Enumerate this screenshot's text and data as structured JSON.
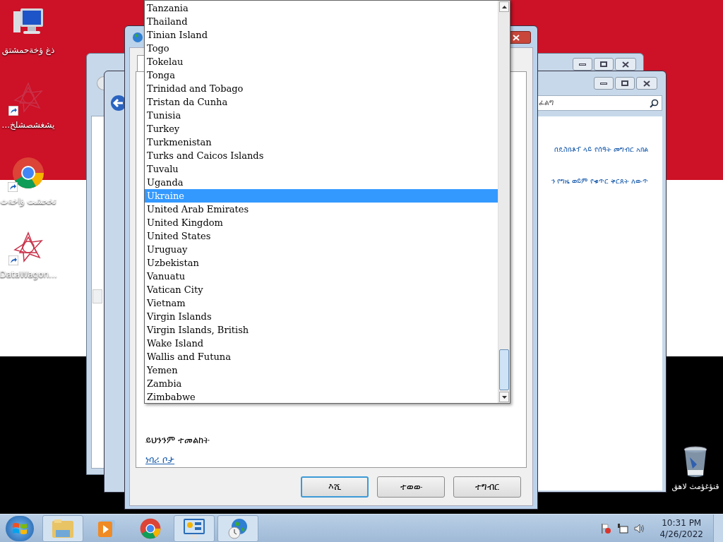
{
  "desktop_icons": [
    {
      "label": "ذغ ؤخةحمشتق",
      "kind": "computer",
      "shortcut": false
    },
    {
      "label": "...يشغشصشلخ",
      "kind": "star",
      "shortcut": true
    },
    {
      "label": "تخحشت ؤاخةث",
      "kind": "chrome",
      "shortcut": true
    },
    {
      "label": "DataWagon...",
      "kind": "star",
      "shortcut": true
    }
  ],
  "recycle_bin": {
    "label": "قنؤغؤمث لاهق"
  },
  "explorer_window": {
    "search_placeholder": "ፈልግ",
    "links": [
      "በዴስክቶፕ ላይ የሰዓት መግብር አክል",
      "ን የግዜ ወይም የቁጥር ቅርጸት ለውጥ"
    ]
  },
  "dialog": {
    "see_also": "ይህንንም ተመልከት",
    "link": "ነባሪ ቦታ",
    "buttons": [
      {
        "label": "እሺ",
        "default": true
      },
      {
        "label": "ተወው",
        "default": false
      },
      {
        "label": "ተግብር",
        "default": false
      }
    ]
  },
  "dropdown": {
    "items": [
      {
        "label": "Tanzania",
        "selected": false
      },
      {
        "label": "Thailand",
        "selected": false
      },
      {
        "label": "Tinian Island",
        "selected": false
      },
      {
        "label": "Togo",
        "selected": false
      },
      {
        "label": "Tokelau",
        "selected": false
      },
      {
        "label": "Tonga",
        "selected": false
      },
      {
        "label": "Trinidad and Tobago",
        "selected": false
      },
      {
        "label": "Tristan da Cunha",
        "selected": false
      },
      {
        "label": "Tunisia",
        "selected": false
      },
      {
        "label": "Turkey",
        "selected": false
      },
      {
        "label": "Turkmenistan",
        "selected": false
      },
      {
        "label": "Turks and Caicos Islands",
        "selected": false
      },
      {
        "label": "Tuvalu",
        "selected": false
      },
      {
        "label": "Uganda",
        "selected": false
      },
      {
        "label": "Ukraine",
        "selected": true
      },
      {
        "label": "United Arab Emirates",
        "selected": false
      },
      {
        "label": "United Kingdom",
        "selected": false
      },
      {
        "label": "United States",
        "selected": false
      },
      {
        "label": "Uruguay",
        "selected": false
      },
      {
        "label": "Uzbekistan",
        "selected": false
      },
      {
        "label": "Vanuatu",
        "selected": false
      },
      {
        "label": "Vatican City",
        "selected": false
      },
      {
        "label": "Vietnam",
        "selected": false
      },
      {
        "label": "Virgin Islands",
        "selected": false
      },
      {
        "label": "Virgin Islands, British",
        "selected": false
      },
      {
        "label": "Wake Island",
        "selected": false
      },
      {
        "label": "Wallis and Futuna",
        "selected": false
      },
      {
        "label": "Yemen",
        "selected": false
      },
      {
        "label": "Zambia",
        "selected": false
      },
      {
        "label": "Zimbabwe",
        "selected": false
      }
    ]
  },
  "taskbar": {
    "apps": [
      {
        "kind": "explorer",
        "active": true
      },
      {
        "kind": "media",
        "active": false
      },
      {
        "kind": "chrome",
        "active": false
      },
      {
        "kind": "control",
        "active": true
      },
      {
        "kind": "globe",
        "active": true
      }
    ],
    "clock": {
      "time": "10:31 PM",
      "date": "4/26/2022"
    }
  }
}
